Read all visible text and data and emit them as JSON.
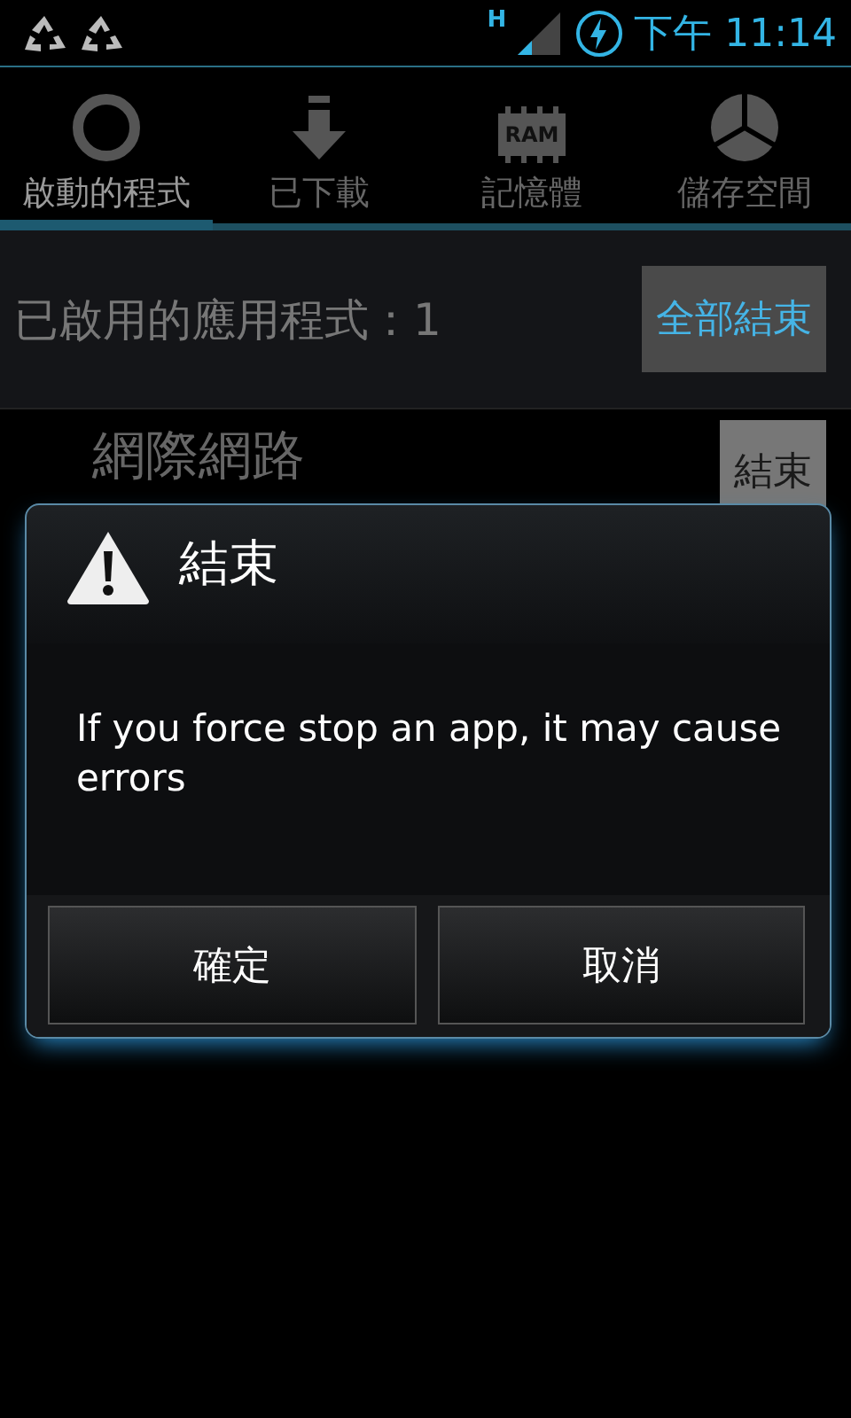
{
  "status_bar": {
    "network": "H",
    "time": "下午 11:14"
  },
  "tabs": [
    {
      "kind": "running",
      "label": "啟動的程式",
      "selected": true
    },
    {
      "kind": "download",
      "label": "已下載",
      "selected": false
    },
    {
      "kind": "ram",
      "icon_text": "RAM",
      "label": "記憶體",
      "selected": false
    },
    {
      "kind": "storage",
      "label": "儲存空間",
      "selected": false
    }
  ],
  "header": {
    "title": "已啟用的應用程式：1",
    "button": "全部結束"
  },
  "apps": [
    {
      "name": "網際網路",
      "button": "結束"
    }
  ],
  "dialog": {
    "title": "結束",
    "message": "If you force stop an app, it may cause errors",
    "buttons": [
      "確定",
      "取消"
    ]
  }
}
